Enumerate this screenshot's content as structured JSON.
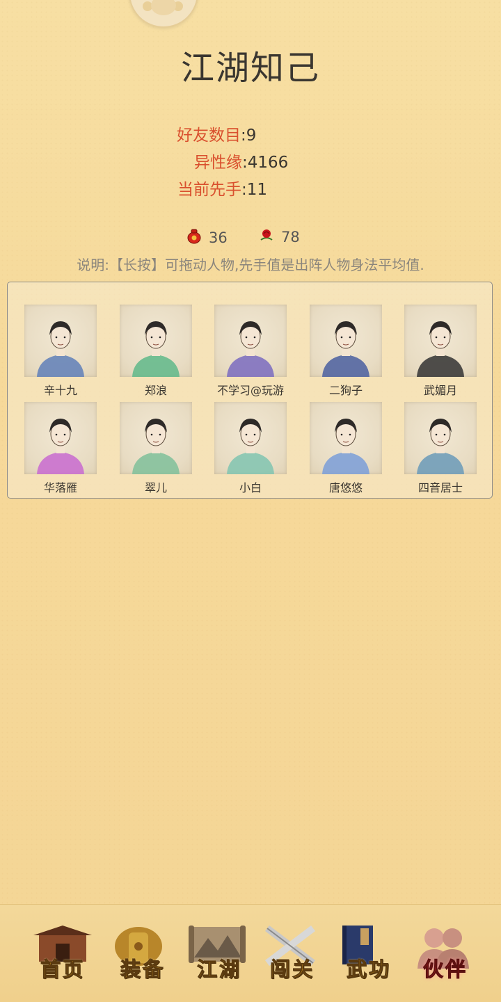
{
  "page": {
    "title": "江湖知己"
  },
  "stats": [
    {
      "label": "好友数目",
      "value": "9"
    },
    {
      "label": "异性缘",
      "value": "4166"
    },
    {
      "label": "当前先手",
      "value": "11"
    }
  ],
  "resources": [
    {
      "icon": "red-pouch-icon",
      "value": "36"
    },
    {
      "icon": "rose-icon",
      "value": "78"
    }
  ],
  "note": "说明:【长按】可拖动人物,先手值是出阵人物身法平均值.",
  "characters": [
    {
      "name": "辛十九",
      "robe": "#5f7fb8"
    },
    {
      "name": "郑浪",
      "robe": "#5fb88a"
    },
    {
      "name": "不学习@玩游",
      "robe": "#7a6bc0"
    },
    {
      "name": "二狗子",
      "robe": "#4a5fa0"
    },
    {
      "name": "武媚月",
      "robe": "#333333"
    },
    {
      "name": "华落雁",
      "robe": "#c86ad0"
    },
    {
      "name": "翠儿",
      "robe": "#7fc09a"
    },
    {
      "name": "小白",
      "robe": "#80c4b0"
    },
    {
      "name": "唐悠悠",
      "robe": "#7a9ed8"
    },
    {
      "name": "四音居士",
      "robe": "#6a9ab8"
    }
  ],
  "nav": {
    "tabs": [
      {
        "label": "首页",
        "icon": "house-icon",
        "active": false
      },
      {
        "label": "装备",
        "icon": "armor-icon",
        "active": false
      },
      {
        "label": "江湖",
        "icon": "map-scroll-icon",
        "active": false
      },
      {
        "label": "闯关",
        "icon": "crossed-swords-icon",
        "active": false
      },
      {
        "label": "武功",
        "icon": "book-icon",
        "active": false
      },
      {
        "label": "伙伴",
        "icon": "companions-icon",
        "active": true
      }
    ]
  }
}
